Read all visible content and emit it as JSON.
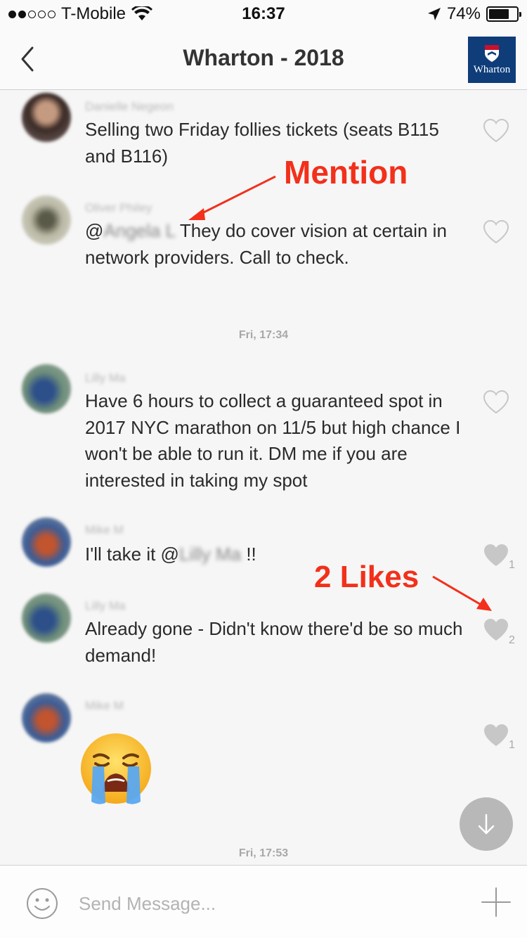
{
  "status_bar": {
    "carrier": "T-Mobile",
    "time": "16:37",
    "battery_pct": "74%",
    "battery_level": 0.74
  },
  "nav": {
    "title": "Wharton - 2018",
    "logo_text": "Wharton"
  },
  "messages": [
    {
      "author": "Danielle Negeon",
      "text": "Selling two Friday follies tickets (seats B115 and B116)",
      "likes": ""
    },
    {
      "author": "Oliver Philey",
      "mention_prefix": "@",
      "mention_name": "Angela L",
      "text": " They do cover vision at certain in network providers. Call to check.",
      "likes": ""
    },
    {
      "author": "Lilly Ma",
      "text": "Have 6 hours to collect a guaranteed spot in 2017 NYC marathon on 11/5 but high chance I won't be able to run it. DM me if you are interested in taking my spot",
      "likes": ""
    },
    {
      "author": "Mike M",
      "text_prefix": "I'll take it @",
      "mention_name": "Lilly Ma",
      "text_suffix": " !!",
      "likes": "1"
    },
    {
      "author": "Lilly Ma",
      "text": "Already gone - Didn't know there'd be so much demand!",
      "likes": "2"
    },
    {
      "author": "Mike M",
      "emoji": "crying-face",
      "likes": "1"
    }
  ],
  "timestamps": [
    "Fri, 17:34",
    "Fri, 17:53"
  ],
  "annotations": {
    "mention": "Mention",
    "likes": "2 Likes"
  },
  "input": {
    "placeholder": "Send Message..."
  },
  "colors": {
    "annotation": "#f2301b",
    "logo_bg": "#0e3d7a",
    "heart": "#c7c7c7"
  }
}
